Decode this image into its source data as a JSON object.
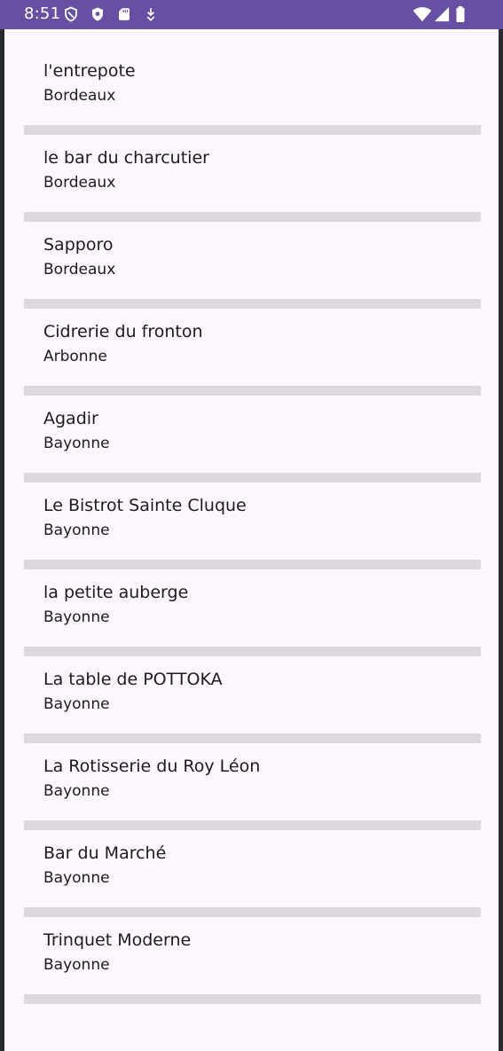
{
  "status_bar": {
    "time": "8:51",
    "left_icons": [
      "shield-outline-icon",
      "shield-check-icon",
      "sd-card-icon",
      "download-arrow-icon"
    ],
    "right_icons": [
      "wifi-icon",
      "signal-icon",
      "battery-icon"
    ]
  },
  "colors": {
    "status_bar": "#6750a4",
    "background": "#fdf7fd",
    "divider": "#ddd8de",
    "text": "#1d1b20"
  },
  "restaurants": [
    {
      "name": "l'entrepote",
      "city": "Bordeaux"
    },
    {
      "name": "le bar du charcutier",
      "city": "Bordeaux"
    },
    {
      "name": "Sapporo",
      "city": "Bordeaux"
    },
    {
      "name": "Cidrerie du fronton",
      "city": "Arbonne"
    },
    {
      "name": "Agadir",
      "city": "Bayonne"
    },
    {
      "name": "Le Bistrot Sainte Cluque",
      "city": "Bayonne"
    },
    {
      "name": "la petite auberge",
      "city": "Bayonne"
    },
    {
      "name": "La table de POTTOKA",
      "city": "Bayonne"
    },
    {
      "name": "La Rotisserie du Roy Léon",
      "city": "Bayonne"
    },
    {
      "name": "Bar du Marché",
      "city": "Bayonne"
    },
    {
      "name": "Trinquet Moderne",
      "city": "Bayonne"
    }
  ]
}
